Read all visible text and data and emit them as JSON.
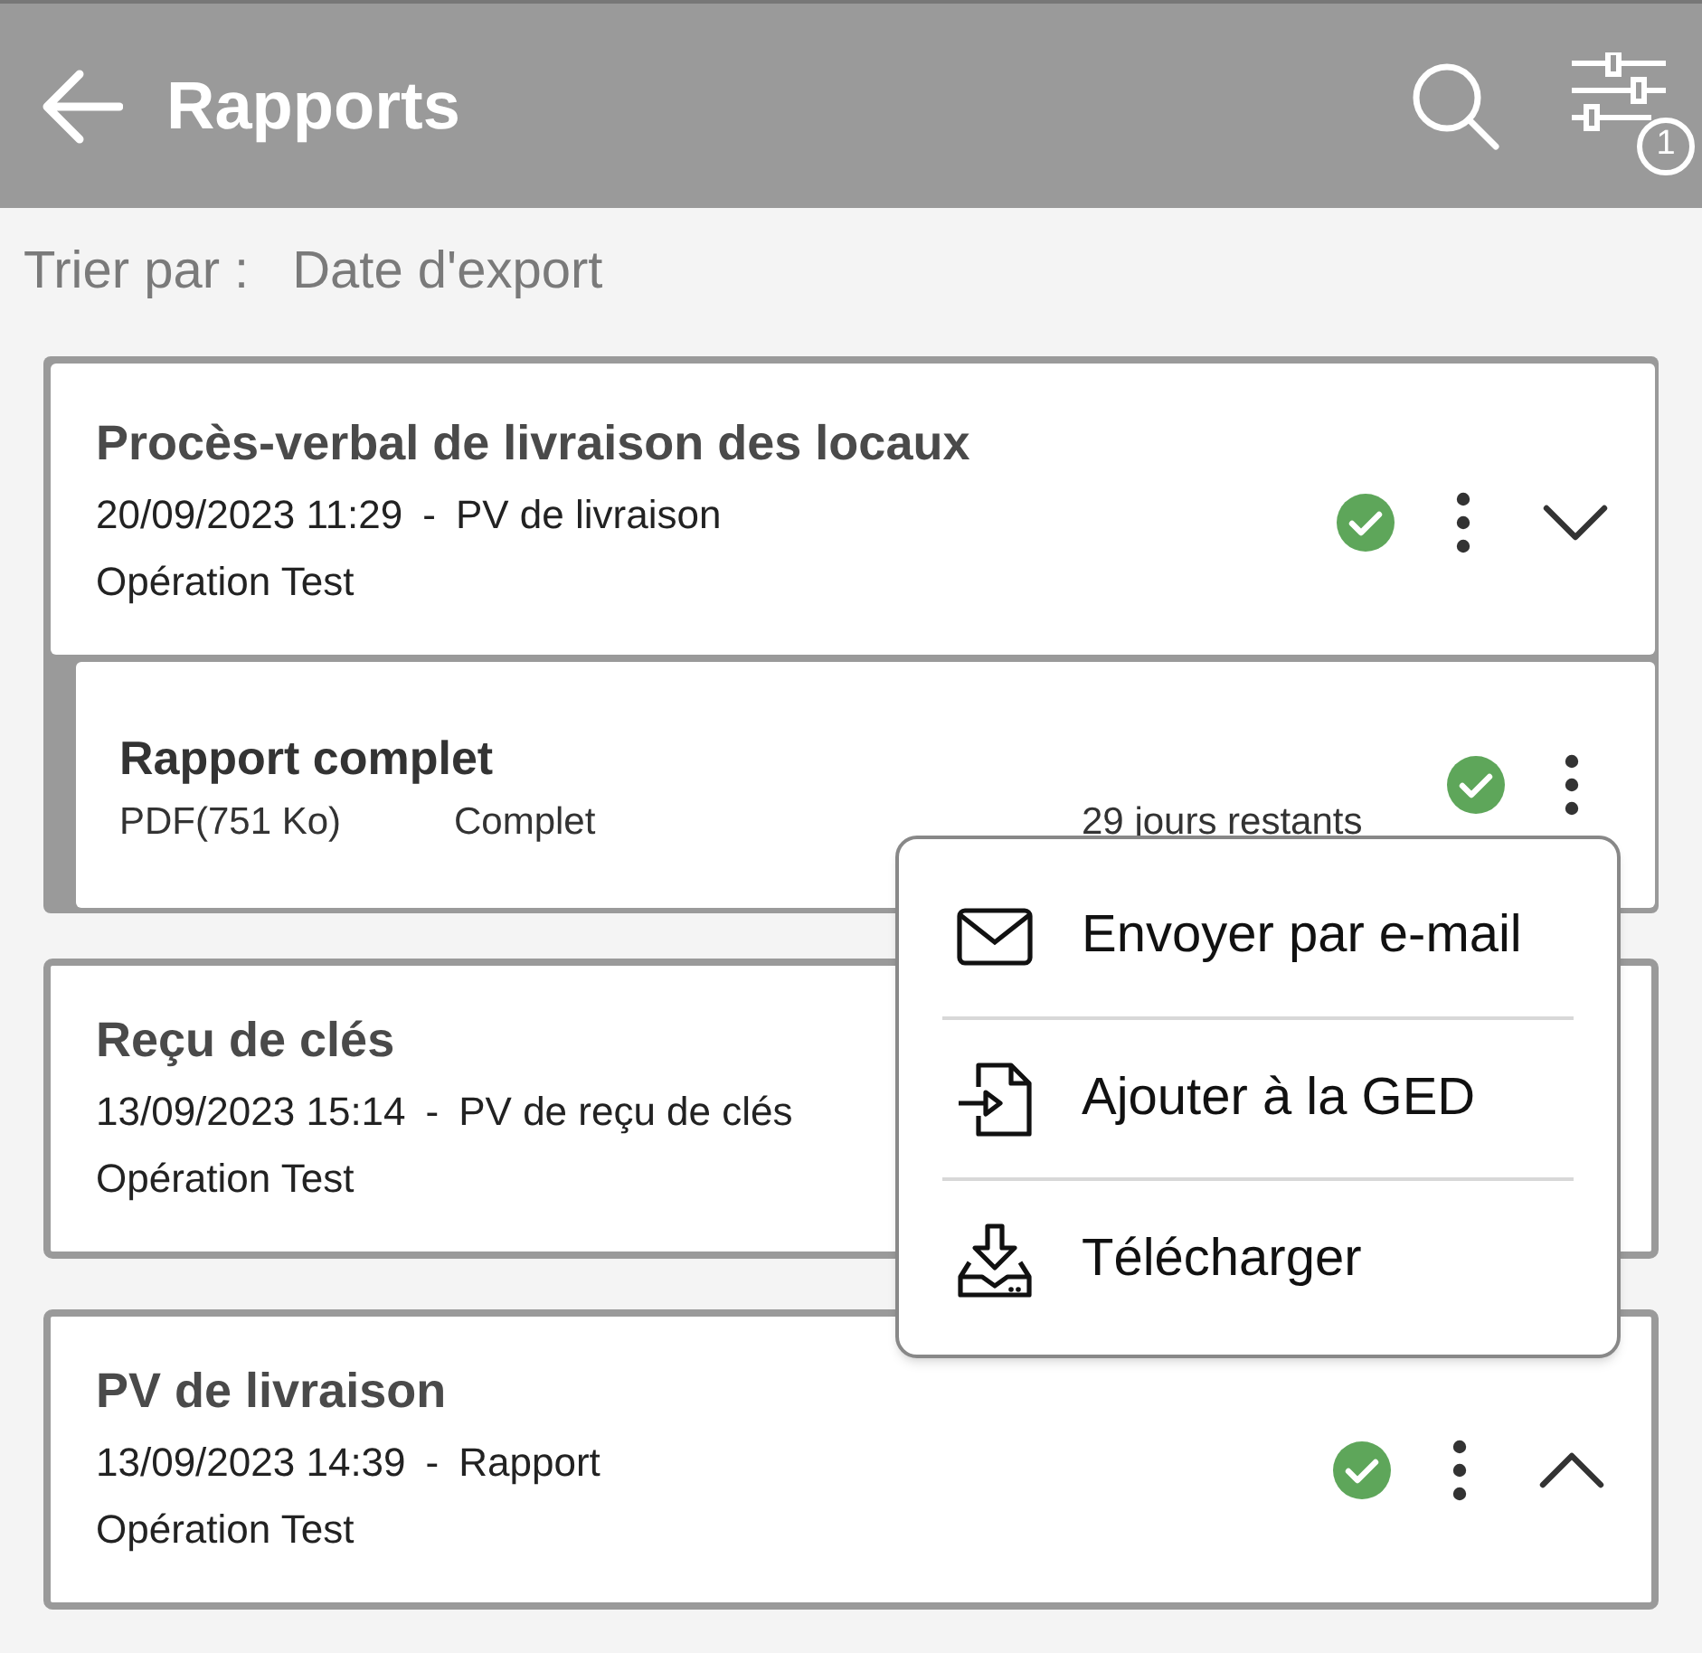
{
  "app_bar": {
    "title": "Rapports",
    "filter_count": "1"
  },
  "sort": {
    "label": "Trier par :",
    "value": "Date d'export"
  },
  "reports": [
    {
      "title": "Procès-verbal de livraison des locaux",
      "date": "20/09/2023 11:29",
      "separator": "-",
      "type": "PV de livraison",
      "operation": "Opération Test",
      "verified": true,
      "expanded": true,
      "children": [
        {
          "title": "Rapport complet",
          "format": "PDF(751 Ko)",
          "scope": "Complet",
          "remaining": "29 jours restants",
          "verified": true
        }
      ]
    },
    {
      "title": "Reçu de clés",
      "date": "13/09/2023 15:14",
      "separator": "-",
      "type": "PV de reçu de clés",
      "operation": "Opération Test"
    },
    {
      "title": "PV de livraison",
      "date": "13/09/2023 14:39",
      "separator": "-",
      "type": "Rapport",
      "operation": "Opération Test",
      "verified": true,
      "expanded": false
    }
  ],
  "menu": {
    "items": [
      {
        "kind": "email",
        "label": "Envoyer par e-mail"
      },
      {
        "kind": "ged",
        "label": "Ajouter à la GED"
      },
      {
        "kind": "download",
        "label": "Télécharger"
      }
    ]
  }
}
